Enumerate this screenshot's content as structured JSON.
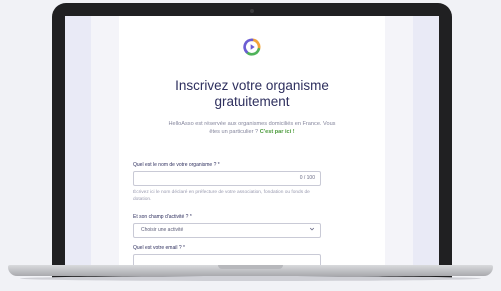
{
  "form": {
    "title_line1": "Inscrivez votre organisme",
    "title_line2": "gratuitement",
    "intro_line1": "HelloAsso est réservée aux organismes domiciliés en France. Vous",
    "intro_line2_prefix": "êtes un particulier ?",
    "intro_link": "C'est par ici !",
    "org_name_label": "Quel est le nom de votre organisme ? *",
    "org_name_counter": "0 / 100",
    "org_name_help": "Écrivez ici le nom déclaré en préfecture de votre association, fondation ou fonds de dotation.",
    "activity_label": "Et son champ d'activité ? *",
    "activity_selected": "Choisir une activité",
    "email_label": "Quel est votre email ? *"
  },
  "colors": {
    "title": "#2e2f5e",
    "link": "#4a9a3a",
    "logo_green": "#4fb35a",
    "logo_orange": "#f2a53b",
    "logo_purple": "#6c5dd3"
  }
}
